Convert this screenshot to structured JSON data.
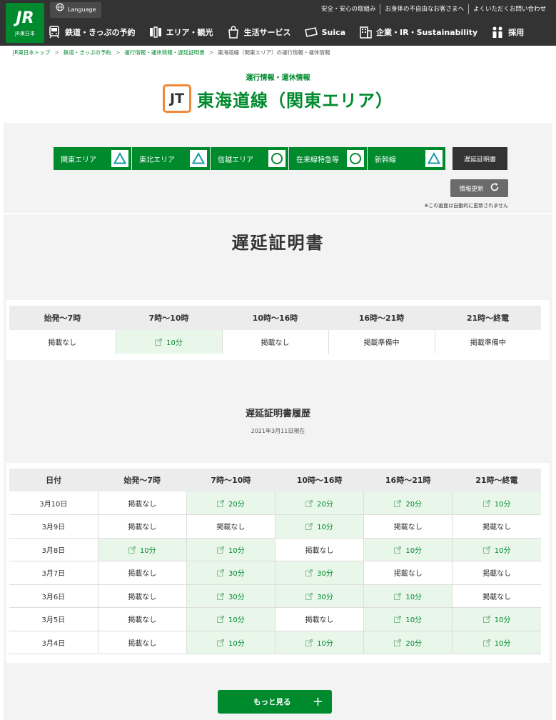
{
  "header": {
    "logo_text": "JR",
    "logo_sub": "JR東日本",
    "language_label": "Language",
    "util_links": [
      "安全・安心の取組み",
      "お身体の不自由なお客さまへ",
      "よくいただくお問い合わせ"
    ],
    "nav": [
      {
        "label": "鉄道・きっぷの予約",
        "icon": "train-icon"
      },
      {
        "label": "エリア・観光",
        "icon": "map-icon"
      },
      {
        "label": "生活サービス",
        "icon": "shopping-bag-icon"
      },
      {
        "label": "Suica",
        "icon": "card-icon"
      },
      {
        "label": "企業・IR・Sustainability",
        "icon": "building-icon"
      },
      {
        "label": "採用",
        "icon": "people-icon"
      }
    ]
  },
  "breadcrumb": [
    "JR東日本トップ",
    "鉄道・きっぷの予約",
    "運行情報・運休情報・遅延証明書",
    "東海道線（関東エリア）の運行情報・運休情報"
  ],
  "page": {
    "supertitle": "運行情報・運休情報",
    "line_code": "JT",
    "line_title": "東海道線（関東エリア）"
  },
  "area_tabs": [
    {
      "label": "関東エリア",
      "mark": "triangle"
    },
    {
      "label": "東北エリア",
      "mark": "triangle"
    },
    {
      "label": "信越エリア",
      "mark": "circle"
    },
    {
      "label": "在来線特急等",
      "mark": "circle"
    },
    {
      "label": "新幹線",
      "mark": "triangle"
    }
  ],
  "delay_cert_button": "遅延証明書",
  "refresh_button": "情報更新",
  "auto_update_note": "※この画面は自動的に更新されません",
  "cert": {
    "title": "遅延証明書",
    "headers": [
      "始発〜7時",
      "7時〜10時",
      "10時〜16時",
      "16時〜21時",
      "21時〜終電"
    ],
    "current": [
      {
        "text": "掲載なし",
        "link": false
      },
      {
        "text": "10分",
        "link": true
      },
      {
        "text": "掲載なし",
        "link": false
      },
      {
        "text": "掲載準備中",
        "link": false
      },
      {
        "text": "掲載準備中",
        "link": false
      }
    ]
  },
  "history": {
    "title": "遅延証明書履歴",
    "as_of": "2021年3月11日現在",
    "headers": [
      "日付",
      "始発〜7時",
      "7時〜10時",
      "10時〜16時",
      "16時〜21時",
      "21時〜終電"
    ],
    "rows": [
      {
        "date": "3月10日",
        "cells": [
          {
            "text": "掲載なし",
            "link": false
          },
          {
            "text": "20分",
            "link": true
          },
          {
            "text": "20分",
            "link": true
          },
          {
            "text": "20分",
            "link": true
          },
          {
            "text": "10分",
            "link": true
          }
        ]
      },
      {
        "date": "3月9日",
        "cells": [
          {
            "text": "掲載なし",
            "link": false
          },
          {
            "text": "掲載なし",
            "link": false
          },
          {
            "text": "10分",
            "link": true
          },
          {
            "text": "掲載なし",
            "link": false
          },
          {
            "text": "掲載なし",
            "link": false
          }
        ]
      },
      {
        "date": "3月8日",
        "cells": [
          {
            "text": "10分",
            "link": true
          },
          {
            "text": "10分",
            "link": true
          },
          {
            "text": "掲載なし",
            "link": false
          },
          {
            "text": "10分",
            "link": true
          },
          {
            "text": "10分",
            "link": true
          }
        ]
      },
      {
        "date": "3月7日",
        "cells": [
          {
            "text": "掲載なし",
            "link": false
          },
          {
            "text": "30分",
            "link": true
          },
          {
            "text": "30分",
            "link": true
          },
          {
            "text": "掲載なし",
            "link": false
          },
          {
            "text": "掲載なし",
            "link": false
          }
        ]
      },
      {
        "date": "3月6日",
        "cells": [
          {
            "text": "掲載なし",
            "link": false
          },
          {
            "text": "30分",
            "link": true
          },
          {
            "text": "30分",
            "link": true
          },
          {
            "text": "10分",
            "link": true
          },
          {
            "text": "掲載なし",
            "link": false
          }
        ]
      },
      {
        "date": "3月5日",
        "cells": [
          {
            "text": "掲載なし",
            "link": false
          },
          {
            "text": "10分",
            "link": true
          },
          {
            "text": "掲載なし",
            "link": false
          },
          {
            "text": "10分",
            "link": true
          },
          {
            "text": "10分",
            "link": true
          }
        ]
      },
      {
        "date": "3月4日",
        "cells": [
          {
            "text": "掲載なし",
            "link": false
          },
          {
            "text": "10分",
            "link": true
          },
          {
            "text": "10分",
            "link": true
          },
          {
            "text": "20分",
            "link": true
          },
          {
            "text": "10分",
            "link": true
          }
        ]
      }
    ]
  },
  "more_button": "もっと見る",
  "colors": {
    "brand_green": "#008a2e",
    "header_bg": "#333333",
    "line_badge_orange": "#f08a3a",
    "mark_teal": "#1a9aa6"
  }
}
